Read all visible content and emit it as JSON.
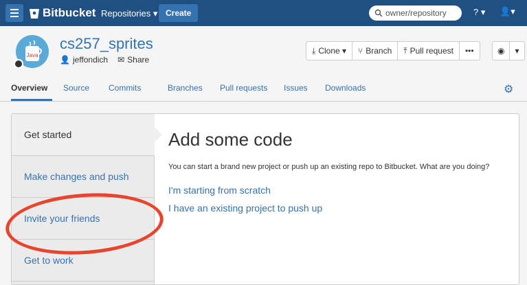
{
  "topbar": {
    "brand": "Bitbucket",
    "repositories": "Repositories ▾",
    "create": "Create",
    "search_placeholder": "owner/repository",
    "help": "? ▾",
    "user": "▾"
  },
  "repo": {
    "name": "cs257_sprites",
    "owner": "jeffondich",
    "share": "Share",
    "avatar_label": "Java"
  },
  "toolbar": {
    "clone": "Clone ▾",
    "branch": "Branch",
    "pull_request": "Pull request",
    "more": "•••",
    "watch": "▾"
  },
  "tabs": [
    {
      "label": "Overview"
    },
    {
      "label": "Source"
    },
    {
      "label": "Commits"
    },
    {
      "label": "Branches"
    },
    {
      "label": "Pull requests"
    },
    {
      "label": "Issues"
    },
    {
      "label": "Downloads"
    }
  ],
  "sidebar": {
    "items": [
      {
        "label": "Get started"
      },
      {
        "label": "Make changes and push"
      },
      {
        "label": "Invite your friends"
      },
      {
        "label": "Get to work"
      }
    ]
  },
  "main": {
    "title": "Add some code",
    "description": "You can start a brand new project or push up an existing repo to Bitbucket. What are you doing?",
    "option1": "I'm starting from scratch",
    "option2": "I have an existing project to push up"
  },
  "colors": {
    "topbar": "#205081",
    "link": "#3572b0",
    "annotation": "#e8452e"
  }
}
